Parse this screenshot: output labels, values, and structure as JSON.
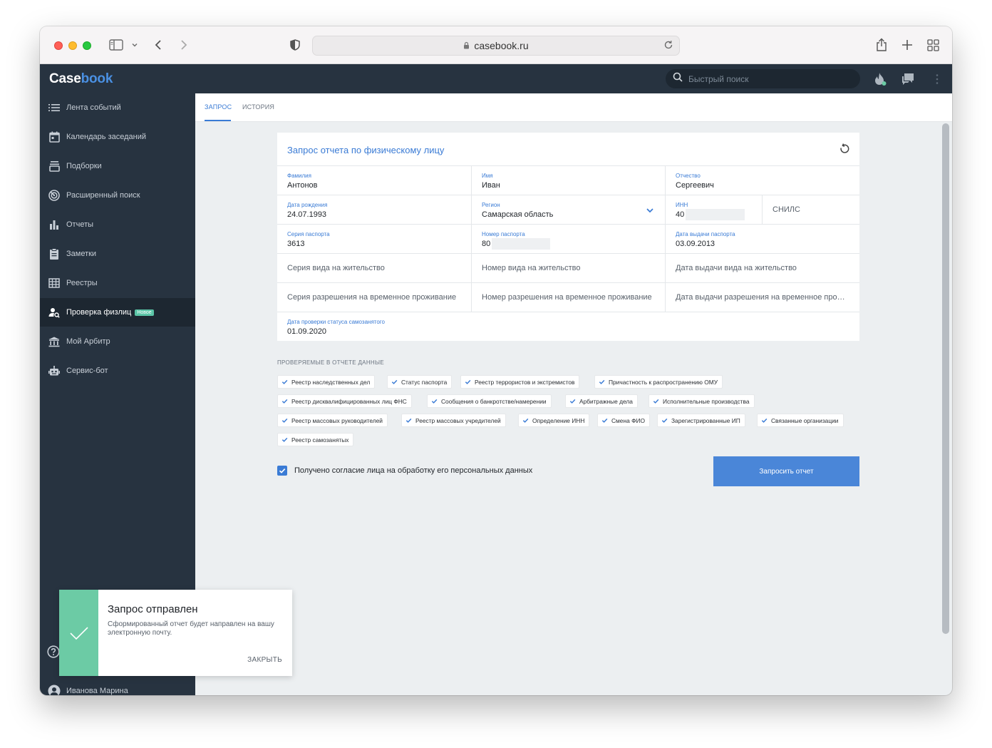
{
  "browser": {
    "url": "casebook.ru"
  },
  "app": {
    "logo_part1": "Case",
    "logo_part2": "book",
    "search_placeholder": "Быстрый поиск"
  },
  "sidebar": {
    "items": [
      {
        "label": "Лента событий",
        "icon": "list-icon"
      },
      {
        "label": "Календарь заседаний",
        "icon": "calendar-icon"
      },
      {
        "label": "Подборки",
        "icon": "tray-icon"
      },
      {
        "label": "Расширенный поиск",
        "icon": "radar-icon"
      },
      {
        "label": "Отчеты",
        "icon": "bar-chart-icon"
      },
      {
        "label": "Заметки",
        "icon": "clipboard-icon"
      },
      {
        "label": "Реестры",
        "icon": "table-icon"
      },
      {
        "label": "Проверка физлиц",
        "icon": "person-search-icon",
        "badge": "Новое"
      },
      {
        "label": "Мой Арбитр",
        "icon": "court-icon"
      },
      {
        "label": "Сервис-бот",
        "icon": "robot-icon"
      }
    ],
    "user_name": "Иванова Марина"
  },
  "tabs": [
    {
      "label": "ЗАПРОС"
    },
    {
      "label": "ИСТОРИЯ"
    }
  ],
  "form": {
    "title": "Запрос отчета по физическому лицу",
    "last_name": {
      "label": "Фамилия",
      "value": "Антонов"
    },
    "first_name": {
      "label": "Имя",
      "value": "Иван"
    },
    "patronymic": {
      "label": "Отчество",
      "value": "Сергеевич"
    },
    "birth_date": {
      "label": "Дата рождения",
      "value": "24.07.1993"
    },
    "region": {
      "label": "Регион",
      "value": "Самарская область"
    },
    "inn": {
      "label": "ИНН",
      "value": "40"
    },
    "snils": {
      "placeholder": "СНИЛС"
    },
    "passport_series": {
      "label": "Серия паспорта",
      "value": "3613"
    },
    "passport_number": {
      "label": "Номер паспорта",
      "value": "80"
    },
    "passport_date": {
      "label": "Дата выдачи паспорта",
      "value": "03.09.2013"
    },
    "residence_series": {
      "placeholder": "Серия вида на жительство"
    },
    "residence_number": {
      "placeholder": "Номер вида на жительство"
    },
    "residence_date": {
      "placeholder": "Дата выдачи вида на жительство"
    },
    "permit_series": {
      "placeholder": "Серия разрешения на временное проживание"
    },
    "permit_number": {
      "placeholder": "Номер разрешения на временное проживание"
    },
    "permit_date": {
      "placeholder": "Дата выдачи разрешения на временное про…"
    },
    "selfemployed_date": {
      "label": "Дата проверки статуса самозанятого",
      "value": "01.09.2020"
    }
  },
  "checks": {
    "title": "ПРОВЕРЯЕМЫЕ В ОТЧЕТЕ ДАННЫЕ",
    "items": [
      "Реестр наследственных дел",
      "Статус паспорта",
      "Реестр террористов и экстремистов",
      "Причастность к распространению ОМУ",
      "Реестр дисквалифицированных лиц ФНС",
      "Сообщения о банкротстве/намерении",
      "Арбитражные дела",
      "Исполнительные производства",
      "Реестр массовых руководителей",
      "Реестр массовых учредителей",
      "Определение ИНН",
      "Смена ФИО",
      "Зарегистрированные ИП",
      "Связанные организации",
      "Реестр самозанятых"
    ]
  },
  "consent_label": "Получено согласие лица на обработку его персональных данных",
  "submit_label": "Запросить отчет",
  "toast": {
    "title": "Запрос отправлен",
    "message": "Сформированный отчет будет направлен на вашу электронную почту.",
    "close_label": "ЗАКРЫТЬ"
  },
  "colors": {
    "sidebar_bg": "#273340",
    "accent": "#3a7bd5",
    "success": "#6ccba5"
  }
}
